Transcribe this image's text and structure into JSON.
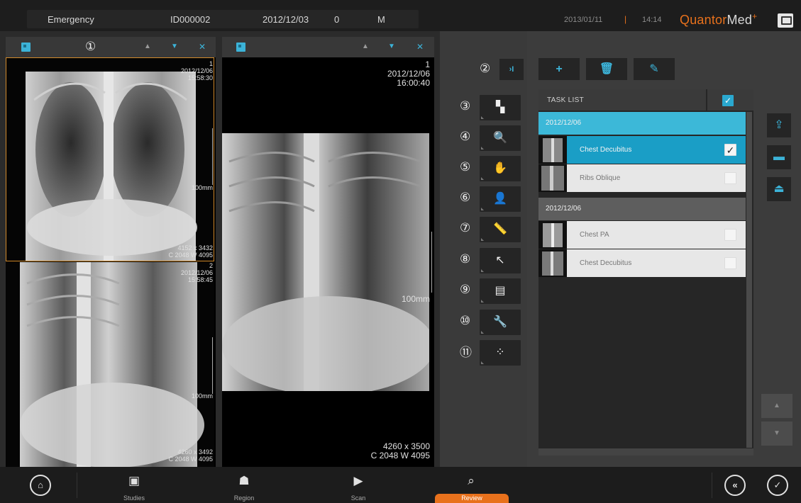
{
  "patient": {
    "name": "Emergency",
    "id": "ID000002",
    "birth_date": "2012/12/03",
    "age": "0",
    "sex": "M"
  },
  "system": {
    "date": "2013/01/11",
    "separator": "|",
    "time": "14:14",
    "brand_part1": "Quantor",
    "brand_part2": "Med",
    "brand_mark": "+",
    "monitor_icon": "monitor-icon"
  },
  "callouts": {
    "c1": "①",
    "c2": "②",
    "c3": "③",
    "c4": "④",
    "c5": "⑤",
    "c6": "⑥",
    "c7": "⑦",
    "c8": "⑧",
    "c9": "⑨",
    "c10": "⑩",
    "c11": "⑪"
  },
  "viewer1": {
    "image1": {
      "index": "1",
      "date": "2012/12/06",
      "time": "15:58:30",
      "scale": "100mm",
      "matrix": "4152 x 3432",
      "window": "C 2048 W 4095"
    },
    "image2": {
      "index": "2",
      "date": "2012/12/06",
      "time": "15:58:45",
      "scale": "100mm",
      "matrix": "4260 x 3492",
      "window": "C 2048 W 4095"
    }
  },
  "viewer2": {
    "index": "1",
    "date": "2012/12/06",
    "time": "16:00:40",
    "scale": "100mm",
    "matrix": "4260 x 3500",
    "window": "C 2048 W 4095"
  },
  "tools": {
    "collapse": "›I",
    "items": [
      {
        "icon": "layout-icon",
        "glyph": "▚"
      },
      {
        "icon": "zoom-icon",
        "glyph": "🔍"
      },
      {
        "icon": "pan-hand-icon",
        "glyph": "✋"
      },
      {
        "icon": "portrait-icon",
        "glyph": "👤"
      },
      {
        "icon": "ruler-icon",
        "glyph": "📏"
      },
      {
        "icon": "transform-icon",
        "glyph": "↖"
      },
      {
        "icon": "report-icon",
        "glyph": "▤"
      },
      {
        "icon": "wrench-icon",
        "glyph": "🔧"
      },
      {
        "icon": "effect-icon",
        "glyph": "⁘"
      }
    ]
  },
  "task_actions": {
    "add": "+",
    "delete": "🗑",
    "edit": "✎"
  },
  "task_list": {
    "title": "TASK LIST",
    "check_all": "✓",
    "groups": [
      {
        "date": "2012/12/06",
        "tasks": [
          {
            "name": "Chest Decubitus",
            "checked": "✓"
          },
          {
            "name": "Ribs Oblique",
            "checked": ""
          }
        ]
      },
      {
        "date": "2012/12/06",
        "tasks": [
          {
            "name": "Chest PA",
            "checked": ""
          },
          {
            "name": "Chest Decubitus",
            "checked": ""
          }
        ]
      }
    ]
  },
  "side_buttons": {
    "export": "⇪",
    "print": "▬",
    "position": "⏏"
  },
  "nav": {
    "up": "▲",
    "down": "▼"
  },
  "bottom": {
    "home": "⌂",
    "studies": "Studies",
    "region": "Region",
    "scan": "Scan",
    "review": "Review",
    "back": "«",
    "confirm": "✓"
  }
}
